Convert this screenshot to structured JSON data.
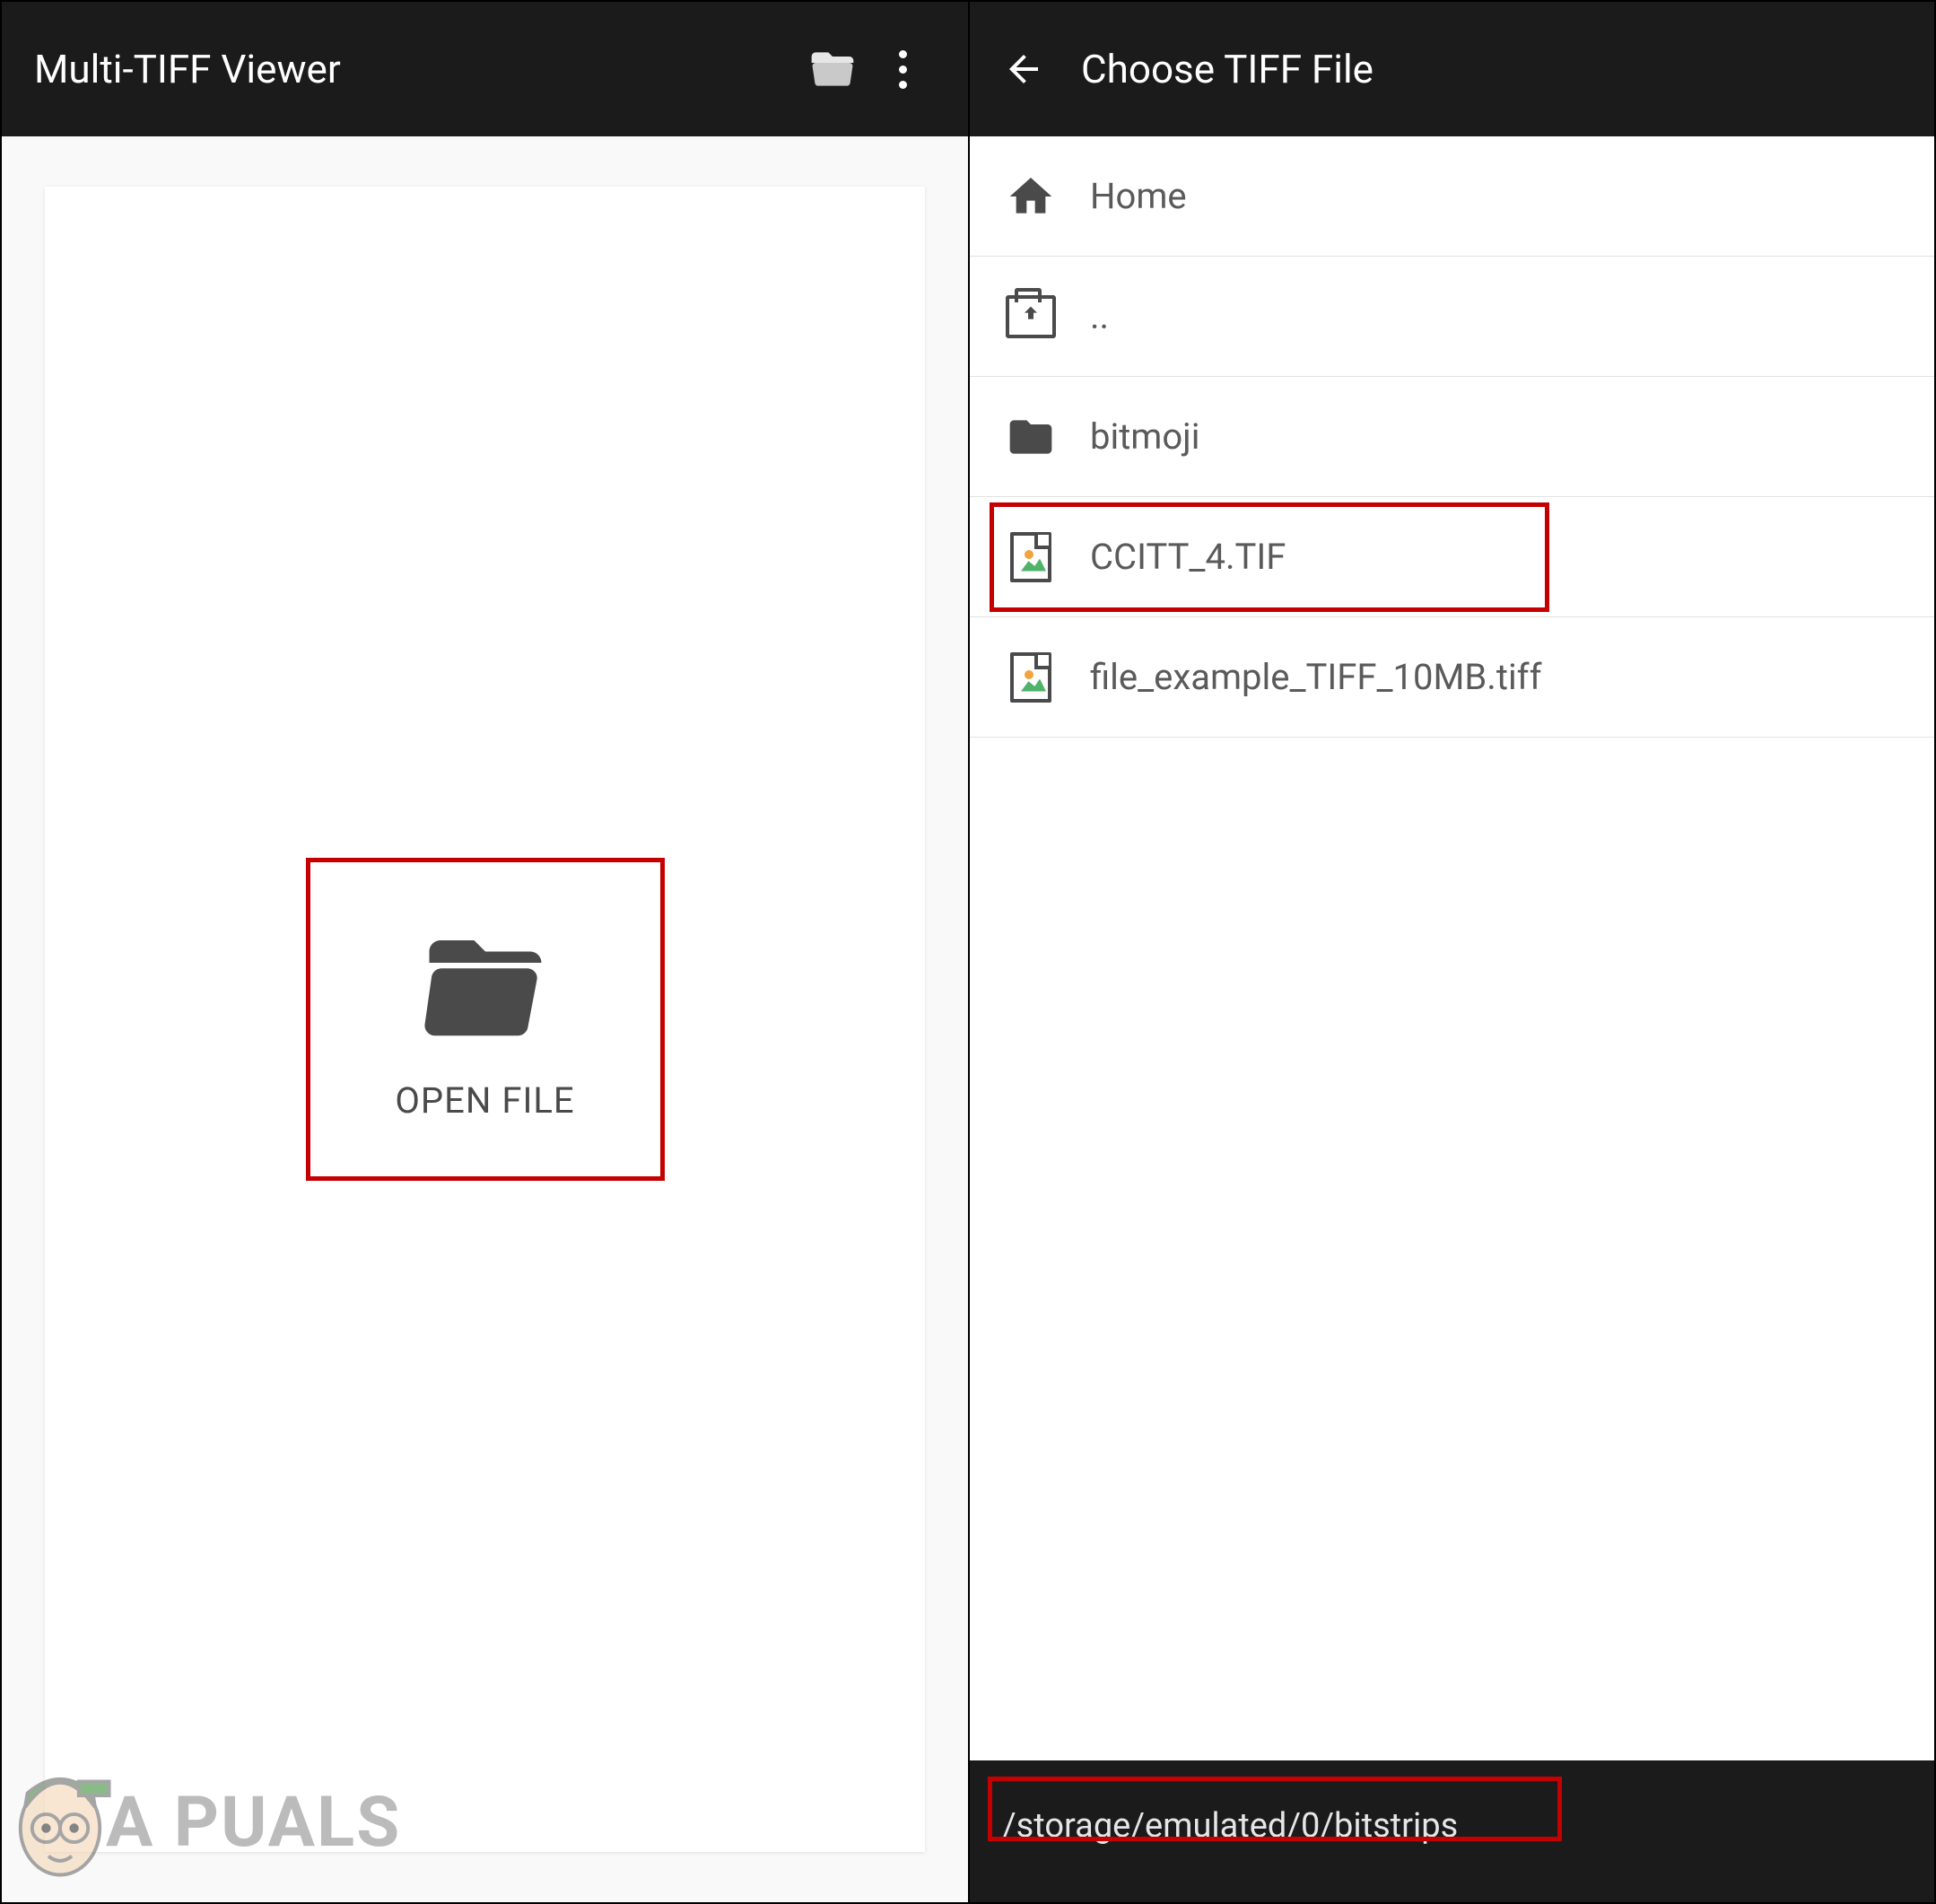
{
  "left": {
    "title": "Multi-TIFF Viewer",
    "open_file_label": "OPEN FILE"
  },
  "right": {
    "title": "Choose TIFF File",
    "items": [
      {
        "label": "Home",
        "type": "home"
      },
      {
        "label": "..",
        "type": "up"
      },
      {
        "label": "bitmoji",
        "type": "folder"
      },
      {
        "label": "CCITT_4.TIF",
        "type": "file",
        "highlighted": true
      },
      {
        "label": "file_example_TIFF_10MB.tiff",
        "type": "file"
      }
    ],
    "path": "/storage/emulated/0/bitstrips"
  },
  "watermark": {
    "text": "A   PUALS"
  }
}
